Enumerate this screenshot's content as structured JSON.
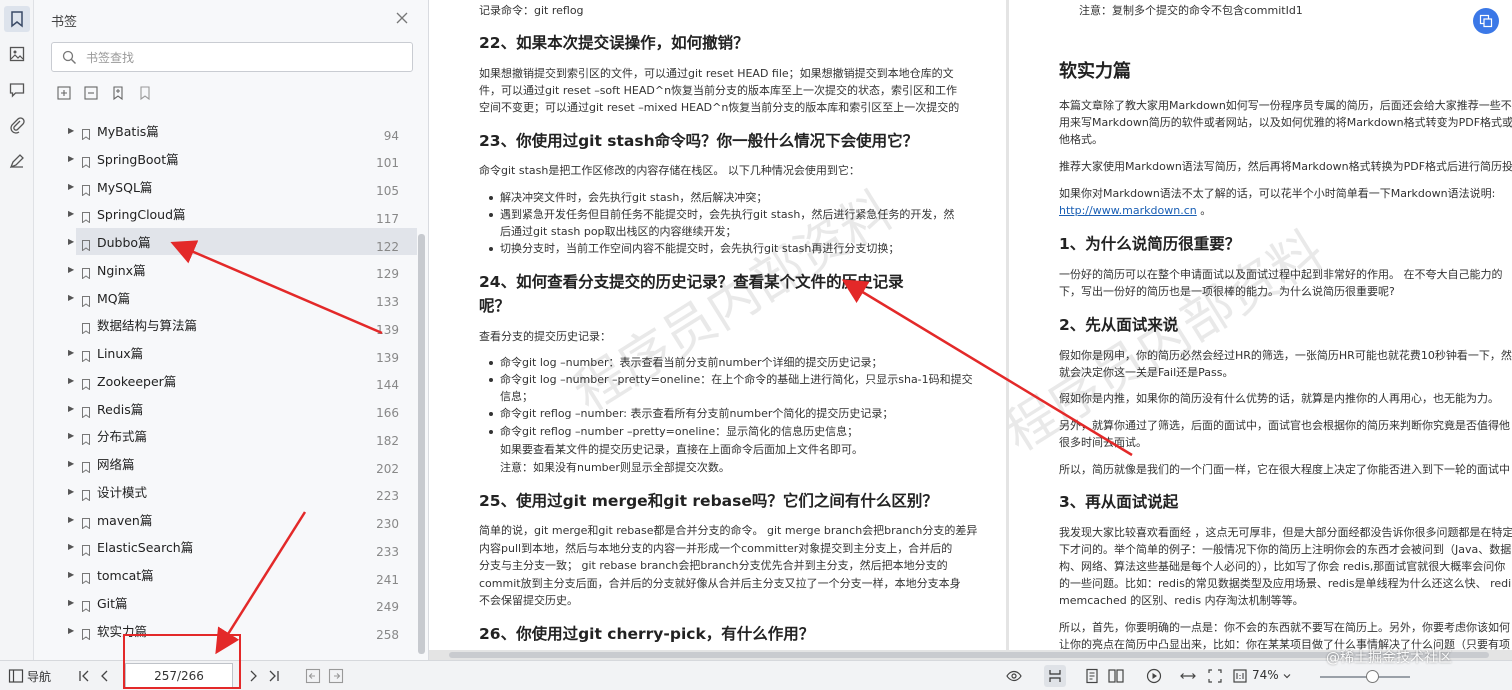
{
  "panel": {
    "title": "书签",
    "search_placeholder": "书签查找"
  },
  "bookmarks": [
    {
      "label": "MyBatis篇",
      "page": "94",
      "expandable": true
    },
    {
      "label": "SpringBoot篇",
      "page": "101",
      "expandable": true
    },
    {
      "label": "MySQL篇",
      "page": "105",
      "expandable": true
    },
    {
      "label": "SpringCloud篇",
      "page": "117",
      "expandable": true
    },
    {
      "label": "Dubbo篇",
      "page": "122",
      "expandable": true,
      "selected": true
    },
    {
      "label": "Nginx篇",
      "page": "129",
      "expandable": true
    },
    {
      "label": "MQ篇",
      "page": "133",
      "expandable": true
    },
    {
      "label": "数据结构与算法篇",
      "page": "139",
      "expandable": false
    },
    {
      "label": "Linux篇",
      "page": "139",
      "expandable": true
    },
    {
      "label": "Zookeeper篇",
      "page": "144",
      "expandable": true
    },
    {
      "label": "Redis篇",
      "page": "166",
      "expandable": true
    },
    {
      "label": "分布式篇",
      "page": "182",
      "expandable": true
    },
    {
      "label": "网络篇",
      "page": "202",
      "expandable": true
    },
    {
      "label": "设计模式",
      "page": "223",
      "expandable": true
    },
    {
      "label": "maven篇",
      "page": "230",
      "expandable": true
    },
    {
      "label": "ElasticSearch篇",
      "page": "233",
      "expandable": true
    },
    {
      "label": "tomcat篇",
      "page": "241",
      "expandable": true
    },
    {
      "label": "Git篇",
      "page": "249",
      "expandable": true
    },
    {
      "label": "软实力篇",
      "page": "258",
      "expandable": true
    }
  ],
  "page1": {
    "l0": "记录命令：git reflog",
    "h22": "22、如果本次提交误操作，如何撤销？",
    "p22a": "如果想撤销提交到索引区的文件，可以通过git reset HEAD file；如果想撤销提交到本地仓库的文",
    "p22b": "件，可以通过git reset –soft HEAD^n恢复当前分支的版本库至上一次提交的状态，索引区和工作",
    "p22c": "空间不变更；可以通过git reset –mixed HEAD^n恢复当前分支的版本库和索引区至上一次提交的",
    "h23": "23、你使用过git stash命令吗？你一般什么情况下会使用它？",
    "p23": "命令git stash是把工作区修改的内容存储在栈区。 以下几种情况会使用到它：",
    "b23a": "解决冲突文件时，会先执行git stash，然后解决冲突；",
    "b23b1": "遇到紧急开发任务但目前任务不能提交时，会先执行git stash，然后进行紧急任务的开发，然",
    "b23b2": "后通过git stash pop取出栈区的内容继续开发；",
    "b23c": "切换分支时，当前工作空间内容不能提交时，会先执行git stash再进行分支切换；",
    "h24a": "24、如何查看分支提交的历史记录？查看某个文件的历史记录",
    "h24b": "呢？",
    "p24": "查看分支的提交历史记录：",
    "b24a": "命令git log –number：表示查看当前分支前number个详细的提交历史记录；",
    "b24b1": "命令git log –number –pretty=oneline：在上个命令的基础上进行简化，只显示sha-1码和提交",
    "b24b2": "信息；",
    "b24c": "命令git reflog –number: 表示查看所有分支前number个简化的提交历史记录；",
    "b24d1": "命令git reflog –number –pretty=oneline：显示简化的信息历史信息；",
    "b24d2": "如果要查看某文件的提交历史记录，直接在上面命令后面加上文件名即可。",
    "b24d3": "注意：如果没有number则显示全部提交次数。",
    "h25": "25、使用过git merge和git rebase吗？它们之间有什么区别？",
    "p25a": "简单的说，git merge和git rebase都是合并分支的命令。 git merge branch会把branch分支的差异",
    "p25b": "内容pull到本地，然后与本地分支的内容一并形成一个committer对象提交到主分支上，合并后的",
    "p25c": "分支与主分支一致； git rebase branch会把branch分支优先合并到主分支，然后把本地分支的",
    "p25d": "commit放到主分支后面，合并后的分支就好像从合并后主分支又拉了一个分支一样，本地分支本身",
    "p25e": "不会保留提交历史。",
    "h26": "26、你使用过git cherry-pick，有什么作用？",
    "watermark": "程序员内部资料"
  },
  "page2": {
    "l0": "注意：复制多个提交的命令不包含commitId1",
    "title": "软实力篇",
    "p1a": "本篇文章除了教大家用Markdown如何写一份程序员专属的简历，后面还会给大家推荐一些不",
    "p1b": "用来写Markdown简历的软件或者网站，以及如何优雅的将Markdown格式转变为PDF格式或",
    "p1c": "他格式。",
    "p2": "推荐大家使用Markdown语法写简历，然后再将Markdown格式转换为PDF格式后进行简历投",
    "p3a": "如果你对Markdown语法不太了解的话，可以花半个小时简单看一下Markdown语法说明:",
    "p3link": "http://www.markdown.cn",
    "p3b": "。",
    "h1": "1、为什么说简历很重要？",
    "p4a": "一份好的简历可以在整个申请面试以及面试过程中起到非常好的作用。 在不夸大自己能力的",
    "p4b": "下，写出一份好的简历也是一项很棒的能力。为什么说简历很重要呢?",
    "h2": "2、先从面试来说",
    "p5a": "假如你是网申，你的简历必然会经过HR的筛选，一张简历HR可能也就花费10秒钟看一下，然",
    "p5b": "就会决定你这一关是Fail还是Pass。",
    "p6": "假如你是内推，如果你的简历没有什么优势的话，就算是内推你的人再用心，也无能为力。",
    "p7a": "另外，就算你通过了筛选，后面的面试中，面试官也会根据你的简历来判断你究竟是否值得他",
    "p7b": "很多时间去面试。",
    "p8": "所以，简历就像是我们的一个门面一样，它在很大程度上决定了你能否进入到下一轮的面试中",
    "h3": "3、再从面试说起",
    "p9a": "我发现大家比较喜欢看面经 ，这点无可厚非，但是大部分面经都没告诉你很多问题都是在特定",
    "p9b": "下才问的。举个简单的例子：一般情况下你的简历上注明你会的东西才会被问到（Java、数据",
    "p9c": "构、网络、算法这些基础是每个人必问的），比如写了你会 redis,那面试官就很大概率会问你",
    "p9d": "的一些问题。比如：redis的常见数据类型及应用场景、redis是单线程为什么还这么快、 redi",
    "p9e": "memcached 的区别、redis 内存淘汰机制等等。",
    "p10a": "所以，首先，你要明确的一点是：你不会的东西就不要写在简历上。另外，你要考虑你该如何",
    "p10b": "让你的亮点在简历中凸显出来，比如：你在某某项目做了什么事情解决了什么问题（只要有项",
    "watermark": "程序员内部资料"
  },
  "statusbar": {
    "nav_label": "导航",
    "page_indicator": "257/266",
    "zoom": "74%",
    "brand": "@稀土掘金技术社区"
  },
  "colors": {
    "accent_blue": "#3b78e7",
    "annotation_red": "#e32929",
    "selected_row": "#e1e4ea"
  }
}
